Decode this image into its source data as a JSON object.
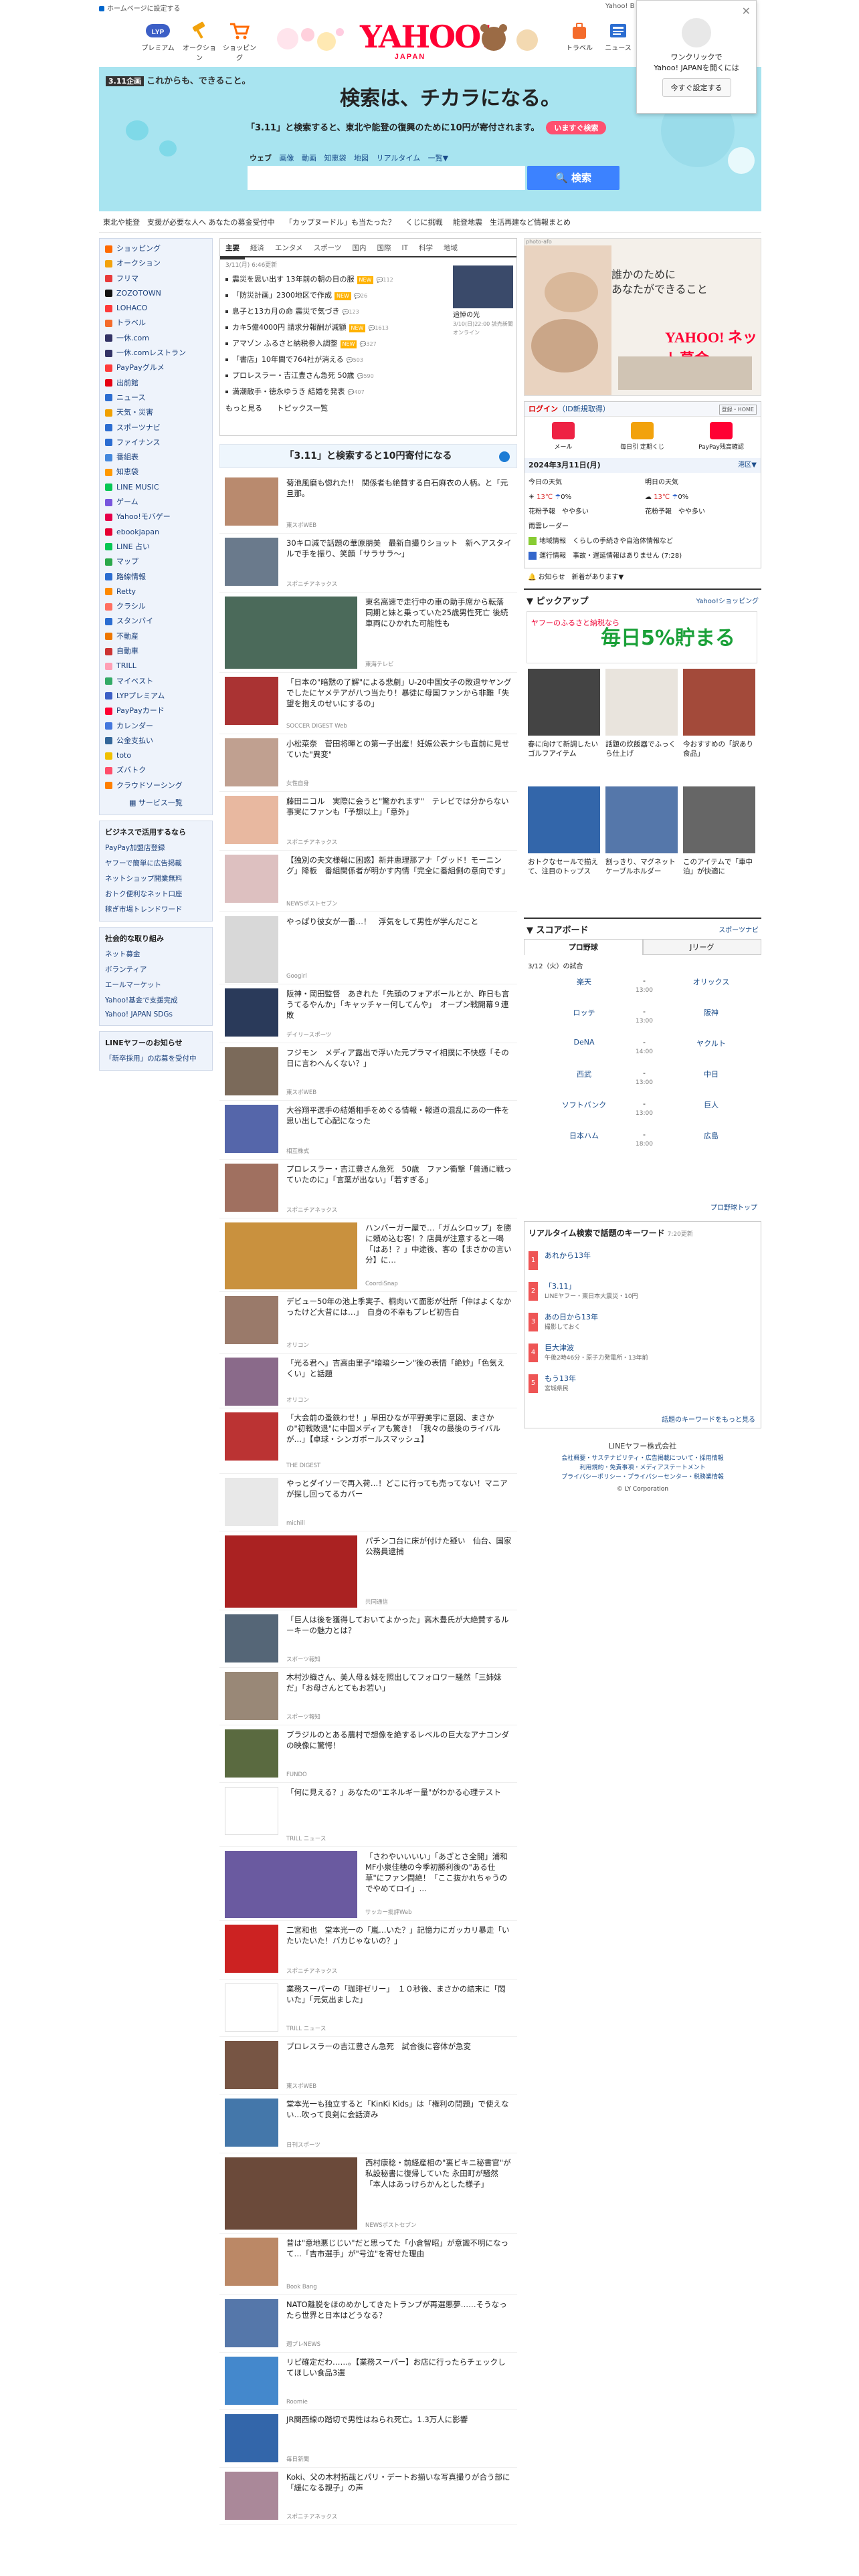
{
  "topbar": {
    "home_link": "ホームページに設定する",
    "right": "Yahoo! B"
  },
  "services": [
    {
      "label": "プレミアム",
      "color": "#3c5fc6"
    },
    {
      "label": "オークション",
      "color": "#f2a20c"
    },
    {
      "label": "ショッピング",
      "color": "#ff6a00"
    },
    {
      "label": "トラベル",
      "color": "#f46b2b"
    },
    {
      "label": "ニュース",
      "color": "#2b6dd1"
    }
  ],
  "logo": {
    "text": "YAHOO!",
    "sub": "JAPAN"
  },
  "popup": {
    "line1": "ワンクリックで",
    "line2": "Yahoo! JAPANを開くには",
    "button": "今すぐ設定する"
  },
  "banner": {
    "tag_badge": "3.11企画",
    "tag": "これからも、できること。",
    "headline": "検索は、チカラになる。",
    "sub": "「3.11」と検索すると、東北や能登の復興のために10円が寄付されます。",
    "more": "いますぐ検索"
  },
  "search": {
    "tabs": [
      "ウェブ",
      "画像",
      "動画",
      "知恵袋",
      "地図",
      "リアルタイム",
      "一覧▼"
    ],
    "button": "検索",
    "placeholder": ""
  },
  "ticker": [
    "東北や能登　支援が必要な人へ あなたの募金受付中",
    "「カップヌードル」も当たった？",
    "くじに挑戦",
    "能登地震　生活再建など情報まとめ"
  ],
  "sidebar": {
    "items": [
      {
        "label": "ショッピング",
        "color": "#ff6a00"
      },
      {
        "label": "オークション",
        "color": "#f2a20c"
      },
      {
        "label": "フリマ",
        "color": "#e83a3a"
      },
      {
        "label": "ZOZOTOWN",
        "color": "#111111"
      },
      {
        "label": "LOHACO",
        "color": "#ff3a3a"
      },
      {
        "label": "トラベル",
        "color": "#f46b2b"
      },
      {
        "label": "一休.com",
        "color": "#333366"
      },
      {
        "label": "一休.comレストラン",
        "color": "#333366"
      },
      {
        "label": "PayPayグルメ",
        "color": "#ff3b3b"
      },
      {
        "label": "出前館",
        "color": "#e60012"
      },
      {
        "label": "ニュース",
        "color": "#2b6dd1"
      },
      {
        "label": "天気・災害",
        "color": "#f0a000"
      },
      {
        "label": "スポーツナビ",
        "color": "#2b6dd1"
      },
      {
        "label": "ファイナンス",
        "color": "#2b6dd1"
      },
      {
        "label": "番組表",
        "color": "#4488dd"
      },
      {
        "label": "知恵袋",
        "color": "#ff9900"
      },
      {
        "label": "LINE MUSIC",
        "color": "#06c755"
      },
      {
        "label": "ゲーム",
        "color": "#7755dd"
      },
      {
        "label": "Yahoo!モバゲー",
        "color": "#e6004c"
      },
      {
        "label": "ebookjapan",
        "color": "#e60033"
      },
      {
        "label": "LINE 占い",
        "color": "#06c755"
      },
      {
        "label": "マップ",
        "color": "#2ba84a"
      },
      {
        "label": "路線情報",
        "color": "#2b6dd1"
      },
      {
        "label": "Retty",
        "color": "#ff8a00"
      },
      {
        "label": "クラシル",
        "color": "#ff6f61"
      },
      {
        "label": "スタンバイ",
        "color": "#2b6dd1"
      },
      {
        "label": "不動産",
        "color": "#ee7700"
      },
      {
        "label": "自動車",
        "color": "#cc3333"
      },
      {
        "label": "TRILL",
        "color": "#ff9fb5"
      },
      {
        "label": "マイベスト",
        "color": "#33aa66"
      },
      {
        "label": "LYPプレミアム",
        "color": "#3c5fc6"
      },
      {
        "label": "PayPayカード",
        "color": "#ff0033"
      },
      {
        "label": "カレンダー",
        "color": "#4477dd"
      },
      {
        "label": "公金支払い",
        "color": "#336699"
      },
      {
        "label": "toto",
        "color": "#f0c000"
      },
      {
        "label": "ズバトク",
        "color": "#ff4d6a"
      },
      {
        "label": "クラウドソーシング",
        "color": "#ff7f00"
      }
    ],
    "more": "サービス一覧",
    "business_title": "ビジネスで活用するなら",
    "business": [
      "PayPay加盟店登録",
      "ヤフーで簡単に広告掲載",
      "ネットショップ開業無料",
      "おトク便利なネット口座",
      "稼ぎ市場トレンドワード"
    ],
    "social_title": "社会的な取り組み",
    "social": [
      "ネット募金",
      "ボランティア",
      "エールマーケット",
      "Yahoo!基金で支援完成",
      "Yahoo! JAPAN SDGs"
    ],
    "notice_title": "LINEヤフーのお知らせ",
    "notice": [
      "「新卒採用」の応募を受付中"
    ]
  },
  "news": {
    "tabs": [
      "主要",
      "経済",
      "エンタメ",
      "スポーツ",
      "国内",
      "国際",
      "IT",
      "科学",
      "地域"
    ],
    "updated": "3/11(月) 6:46更新",
    "items": [
      {
        "title": "震災を思い出す 13年前の朝の日の服",
        "badge": "NEW",
        "comments": "112"
      },
      {
        "title": "「防災計画」2300地区で作成",
        "badge": "NEW",
        "comments": "26"
      },
      {
        "title": "息子と13カ月の命 震災で気づき",
        "badge": "",
        "comments": "123"
      },
      {
        "title": "カキ5億4000円 請求分報酬が減額",
        "badge": "NEW",
        "comments": "1613"
      },
      {
        "title": "アマゾン ふるさと納税参入調整",
        "badge": "NEW",
        "comments": "327"
      },
      {
        "title": "「書店」10年間で764社が消える",
        "badge": "",
        "comments": "503"
      },
      {
        "title": "プロレスラー・吉江豊さん急死 50歳",
        "badge": "",
        "comments": "590"
      },
      {
        "title": "満潮散手・徳永ゆうき 結婚を発表",
        "badge": "",
        "comments": "407"
      }
    ],
    "more1": "もっと見る",
    "more2": "トピックス一覧",
    "thumb_title": "追悼の光",
    "thumb_src": "3/10(日)22:00 読売新聞オンライン"
  },
  "campaign": "「3.11」と検索すると10円寄付になる",
  "feed": [
    {
      "title": "菊池風磨も惚れた!!　関係者も絶賛する白石麻衣の人柄。と「元旦那。",
      "src": "東スポWEB",
      "h": 90,
      "tw": 80,
      "th": 72,
      "color": "#b98a6e"
    },
    {
      "title": "30キロ減で話題の華原朋美　最新自撮りショット　新ヘアスタイルで手を振り、笑顔「サラサラ～」",
      "src": "スポニチアネックス",
      "h": 88,
      "tw": 80,
      "th": 72,
      "color": "#6a7a8c"
    },
    {
      "title": "東名高速で走行中の車の助手席から転落 同期と妹と乗っていた25歳男性死亡 後続車両にひかれた可能性も",
      "src": "東海テレビ",
      "h": 120,
      "tw": 198,
      "th": 108,
      "color": "#4b6a5a"
    },
    {
      "title": "「日本の\"暗黙の了解\"による悲劇」U-20中国女子の敗退サヤングでしたにヤメテアが八つ当たり！暴徒に母国ファンから非難「失望を抱えのせいにするの」",
      "src": "SOCCER DIGEST Web",
      "h": 92,
      "tw": 80,
      "th": 72,
      "color": "#aa3333"
    },
    {
      "title": "小松菜奈　菅田将暉との第一子出産！妊娠公表ナシも直前に見せていた\"異変\"",
      "src": "女性自身",
      "h": 86,
      "tw": 80,
      "th": 72,
      "color": "#c0a090"
    },
    {
      "title": "藤田ニコル　実際に会うと\"驚かれます\"　テレビでは分からない事実にファンも「予想以上」「意外」",
      "src": "スポニチアネックス",
      "h": 88,
      "tw": 80,
      "th": 72,
      "color": "#e8b8a0"
    },
    {
      "title": "【独別の夫文様報に困惑】新井恵理那アナ「グッド！モーニング」降板　番組関係者が明かす内情「完全に番組側の意向です」",
      "src": "NEWSポストセブン",
      "h": 92,
      "tw": 80,
      "th": 72,
      "color": "#ddc0c0"
    },
    {
      "title": "やっぱり彼女が一番…！　浮気をして男性が学んだこと",
      "src": "Googirl",
      "h": 108,
      "tw": 80,
      "th": 100,
      "color": "#d8d8d8"
    },
    {
      "title": "阪神・岡田監督　あきれた「先頭のフォアボールとか、昨日も言うてるやんか」「キャッチャー何してんや」　オープン戦開幕９連敗",
      "src": "デイリースポーツ",
      "h": 88,
      "tw": 80,
      "th": 72,
      "color": "#2a3a5a"
    },
    {
      "title": "フジモン　メディア露出で浮いた元プラマイ相撲に不快感「その日に言わへんくない？」",
      "src": "東スポWEB",
      "h": 86,
      "tw": 80,
      "th": 72,
      "color": "#7b6a5a"
    },
    {
      "title": "大谷翔平選手の結婚相手をめぐる情報・報道の混乱にあの一件を思い出して心配になった",
      "src": "相互株式",
      "h": 88,
      "tw": 80,
      "th": 72,
      "color": "#5566aa"
    },
    {
      "title": "プロレスラー・吉江豊さん急死　50歳　ファン衝撃「普通に戦っていたのに」「言葉が出ない」「若すぎる」",
      "src": "スポニチアネックス",
      "h": 88,
      "tw": 80,
      "th": 72,
      "color": "#a07060"
    },
    {
      "title": "ハンバーガー屋で…「ガムシロップ」を勝に頼め込む客！？店員が注意すると一喝「はあ！？」中途後、客の【まさかの言い分】に…",
      "src": "CoordiSnap",
      "h": 110,
      "tw": 198,
      "th": 100,
      "color": "#c9913e"
    },
    {
      "title": "デビュー50年の池上季実子、桐肉いて面影が壮所「仲はよくなかったけど大昔には…」　自身の不幸もプレビ初告白",
      "src": "オリコン",
      "h": 92,
      "tw": 80,
      "th": 72,
      "color": "#9a7a6a"
    },
    {
      "title": "「光る君へ」吉高由里子\"暗暗シーン\"後の表情「絶妙」「色気えくい」と話題",
      "src": "オリコン",
      "h": 82,
      "tw": 80,
      "th": 72,
      "color": "#8a6a8a"
    },
    {
      "title": "「大会前の蚤鉄わせ！」早田ひなが平野美宇に意図、まさかの\"初戦敗退\"に中国メディアも驚き！「我々の最後のライバルが…」【卓球・シンガポールスマッシュ】",
      "src": "THE DIGEST",
      "h": 98,
      "tw": 80,
      "th": 72,
      "color": "#bb3333"
    },
    {
      "title": "やっとダイソーで再入荷…！どこに行っても売ってない！マニアが探し回ってるカバー",
      "src": "michill",
      "h": 86,
      "tw": 80,
      "th": 72,
      "color": "#e8e8e8"
    },
    {
      "title": "パチンコ台に床が付けた疑い　仙台、国家公務員逮捕",
      "src": "共同通信",
      "h": 118,
      "tw": 198,
      "th": 108,
      "color": "#aa2222"
    },
    {
      "title": "「巨人は後を獲得しておいてよかった」高木豊氏が大絶賛するルーキーの魅力とは？",
      "src": "スポーツ報知",
      "h": 86,
      "tw": 80,
      "th": 72,
      "color": "#556677"
    },
    {
      "title": "木村沙織さん、美人母＆妹を照出してフォロワー騒然「三姉妹だ」「お母さんとてもお若い」",
      "src": "スポーツ報知",
      "h": 86,
      "tw": 80,
      "th": 72,
      "color": "#998877"
    },
    {
      "title": "ブラジルのとある農村で想像を絶するレベルの巨大なアナコンダの映像に驚愕！",
      "src": "FUNDO",
      "h": 86,
      "tw": 80,
      "th": 72,
      "color": "#5a6a40"
    },
    {
      "title": "「何に見える？」あなたの\"エネルギー量\"がわかる心理テスト",
      "src": "TRILL ニュース",
      "h": 96,
      "tw": 80,
      "th": 72,
      "color": "#ffffff"
    },
    {
      "title": "「さわやいいいい」「あざとさ全開」浦和MF小泉佳穂の今季初勝利後の\"ある仕草\"にファン問絶！「ここ抜かれちゃうのでやめてロイ」…",
      "src": "サッカー批評Web",
      "h": 110,
      "tw": 198,
      "th": 100,
      "color": "#6a5aa0"
    },
    {
      "title": "二宮和也　堂本光一の「嵐…いた？」記憶力にガッカリ暴走「いたいたいた！バカじゃないの？」",
      "src": "スポニチアネックス",
      "h": 88,
      "tw": 80,
      "th": 72,
      "color": "#cc2222"
    },
    {
      "title": "業務スーパーの「珈琲ゼリー」　１０秒後、まさかの結末に「悶いた」「元気出ました」",
      "src": "TRILL ニュース",
      "h": 86,
      "tw": 80,
      "th": 72,
      "color": "#ffffff"
    },
    {
      "title": "プロレスラーの吉江豊さん急死　試合後に容体が急変",
      "src": "東スポWEB",
      "h": 86,
      "tw": 80,
      "th": 72,
      "color": "#775544"
    },
    {
      "title": "堂本光一も独立すると「KinKi Kids」は「権利の問題」で使えない…吹って良剣に会話済み",
      "src": "日刊スポーツ",
      "h": 88,
      "tw": 80,
      "th": 72,
      "color": "#4477aa"
    },
    {
      "title": "西村康稔・前経産相の\"裏ビキニ秘書官\"が私設秘書に復帰していた 永田町が騒然「本人はあっけらかんとした様子」",
      "src": "NEWSポストセブン",
      "h": 120,
      "tw": 198,
      "th": 108,
      "color": "#6b4a3a"
    },
    {
      "title": "昔は\"意地悪じじい\"だと思ってた「小倉智昭」が意識不明になって…「吉市選手」が\"号泣\"を寄せた理由",
      "src": "Book Bang",
      "h": 92,
      "tw": 80,
      "th": 72,
      "color": "#bb8866"
    },
    {
      "title": "NATO離脱をほのめかしてきたトランプが再選悪夢……そうなったら世界と日本はどうなる？",
      "src": "週プレNEWS",
      "h": 86,
      "tw": 80,
      "th": 72,
      "color": "#5577aa"
    },
    {
      "title": "リピ確定だわ……。【業務スーパー】お店に行ったらチェックしてほしい食品3選",
      "src": "Roomie",
      "h": 86,
      "tw": 80,
      "th": 72,
      "color": "#4488cc"
    },
    {
      "title": "JR関西線の踏切で男性はねられ死亡。1.3万人に影響",
      "src": "毎日新聞",
      "h": 86,
      "tw": 80,
      "th": 72,
      "color": "#3366aa"
    },
    {
      "title": "Koki、父の木村拓哉とパリ・デートお揃いな写真撮りが合う部に「緩になる親子」の声",
      "src": "スポニチアネックス",
      "h": 86,
      "tw": 80,
      "th": 72,
      "color": "#aa8899"
    }
  ],
  "ad": {
    "label": "photo-afo",
    "line1": "誰かのために",
    "line2": "あなたができること",
    "brand": "YAHOO! ネット募金"
  },
  "login": {
    "head": "ログイン",
    "head_note": "ID新規取得",
    "register": "登録・HOME",
    "icons": [
      {
        "label": "メール",
        "color": "#ee2244"
      },
      {
        "label": "毎日引 定期くじ",
        "color": "#f2a20c"
      },
      {
        "label": "PayPay残高確認",
        "color": "#ff0033"
      }
    ],
    "date": "2024年3月11日(月)",
    "region": "港区▼",
    "today_label": "今日の天気",
    "today_temp": "13℃",
    "today_rain": "0%",
    "tomorrow_label": "明日の天気",
    "tomorrow_temp": "13℃",
    "tomorrow_rain": "0%",
    "pollen_today": "花粉予報　やや多い",
    "pollen_tomorrow": "花粉予報　やや多い",
    "radar": "雨雲レーダー",
    "line1": "地域情報　くらしの手続きや自治体情報など",
    "line2": "運行情報　事故・遅延情報はありません (7:28)",
    "line3": "お知らせ　新着があります▼"
  },
  "pickup": {
    "title": "ピックアップ",
    "source": "Yahoo!ショッピング",
    "banner_top": "ヤフーのふるさと納税なら",
    "banner_big": "毎日5%貯まる",
    "items": [
      "春に向けて新調したいゴルフアイテム",
      "話題の炊飯器でふっくら仕上げ",
      "今おすすめの「訳あり食品」",
      "おトクなセールで揃えて、注目のトップス",
      "割っきり、マグネットケーブルホルダー",
      "このアイテムで「車中泊」が快適に"
    ]
  },
  "scoreboard": {
    "title": "スコアボード",
    "source": "スポーツナビ",
    "tab1": "プロ野球",
    "tab2": "Jリーグ",
    "date": "3/12（火）の試合",
    "games": [
      {
        "home": "楽天",
        "away": "オリックス",
        "mid": "-",
        "time": "13:00"
      },
      {
        "home": "ロッテ",
        "away": "阪神",
        "mid": "-",
        "time": "13:00"
      },
      {
        "home": "DeNA",
        "away": "ヤクルト",
        "mid": "-",
        "time": "14:00"
      },
      {
        "home": "西武",
        "away": "中日",
        "mid": "-",
        "time": "13:00"
      },
      {
        "home": "ソフトバンク",
        "away": "巨人",
        "mid": "-",
        "time": "13:00"
      },
      {
        "home": "日本ハム",
        "away": "広島",
        "mid": "-",
        "time": "18:00"
      }
    ],
    "more": "プロ野球トップ"
  },
  "realtime": {
    "title": "リアルタイム検索で話題のキーワード",
    "time": "7:20更新",
    "keywords": [
      {
        "rank": "1",
        "word": "あれから13年",
        "desc": ""
      },
      {
        "rank": "2",
        "word": "「3.11」",
        "desc": "LINEヤフー・東日本大震災・10円"
      },
      {
        "rank": "3",
        "word": "あの日から13年",
        "desc": "撮影しておく"
      },
      {
        "rank": "4",
        "word": "巨大津波",
        "desc": "午後2時46分・原子力発電所・13年前"
      },
      {
        "rank": "5",
        "word": "もう13年",
        "desc": "宮城県民"
      }
    ],
    "more": "話題のキーワードをもっと見る"
  },
  "footer": {
    "company": "LINEヤフー株式会社",
    "line1": "会社概要・サステナビリティ・広告掲載について・採用情報",
    "line2": "利用規約・免責事項・メディアステートメント",
    "line3": "プライバシーポリシー・プライバシーセンター・税務業情報",
    "copy": "© LY Corporation"
  }
}
